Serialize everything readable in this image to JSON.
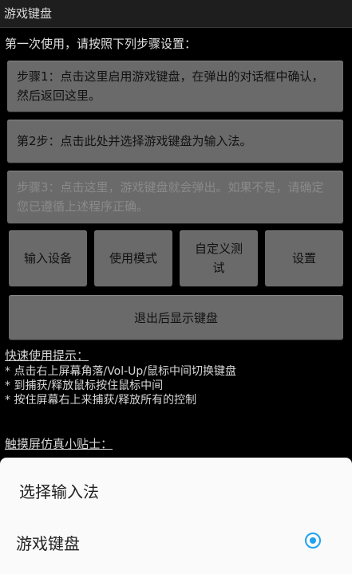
{
  "titlebar": {
    "title": "游戏键盘"
  },
  "intro": "第一次使用，请按照下列步骤设置：",
  "steps": [
    {
      "text": "步骤1：点击这里启用游戏键盘，在弹出的对话框中确认，然后返回这里。",
      "enabled": true
    },
    {
      "text": "第2步：点击此处并选择游戏键盘为输入法。",
      "enabled": true
    },
    {
      "text": "步骤3：点击这里，游戏键盘就会弹出。如果不是，请确定您已遵循上述程序正确。",
      "enabled": false
    }
  ],
  "buttons": {
    "input_device": "输入设备",
    "use_mode": "使用模式",
    "custom_test": "自定义测试",
    "settings": "设置",
    "show_keyboard_after_exit": "退出后显示键盘"
  },
  "quick_tips": {
    "heading": "快速使用提示：",
    "lines": [
      "* 点击右上屏幕角落/Vol-Up/鼠标中间切换键盘",
      "* 到捕获/释放鼠标按住鼠标中间",
      "* 按住屏幕右上来捕获/释放所有的控制"
    ]
  },
  "touch_tips": {
    "heading": "触摸屏仿真小贴士："
  },
  "input_method_sheet": {
    "title": "选择输入法",
    "options": [
      {
        "label": "游戏键盘",
        "selected": true
      }
    ]
  },
  "colors": {
    "accent": "#1fa1f0",
    "button": "#6a6a6a",
    "background": "#000000"
  }
}
